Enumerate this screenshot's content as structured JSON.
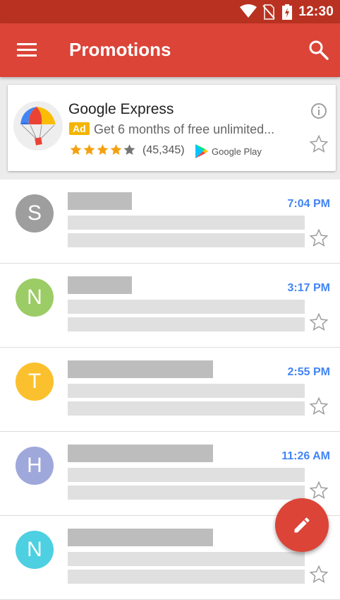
{
  "status_bar": {
    "time": "12:30"
  },
  "app_bar": {
    "title": "Promotions"
  },
  "ad": {
    "title": "Google Express",
    "badge": "Ad",
    "text": "Get 6 months of free unlimited...",
    "rating_count": "(45,345)",
    "rating": 4,
    "rating_max": 5,
    "store_label": "Google Play"
  },
  "emails": [
    {
      "initial": "S",
      "avatar_color": "#9e9e9e",
      "time": "7:04 PM"
    },
    {
      "initial": "N",
      "avatar_color": "#9ccc65",
      "time": "3:17 PM"
    },
    {
      "initial": "T",
      "avatar_color": "#fbc02d",
      "time": "2:55 PM"
    },
    {
      "initial": "H",
      "avatar_color": "#9fa8da",
      "time": "11:26 AM"
    },
    {
      "initial": "N",
      "avatar_color": "#4dd0e1",
      "time": ""
    }
  ],
  "colors": {
    "accent": "#db4437",
    "status": "#b93221",
    "time_blue": "#4285f4"
  }
}
